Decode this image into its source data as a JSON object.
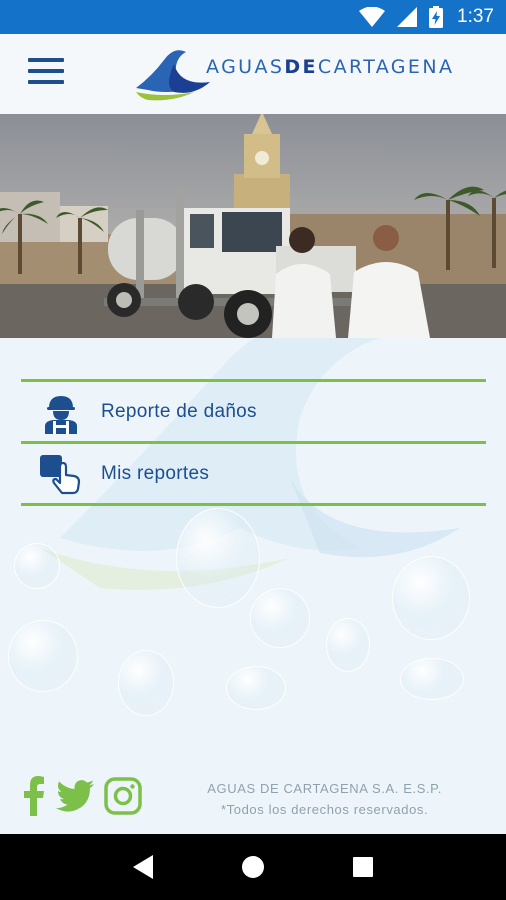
{
  "status_bar": {
    "time": "1:37",
    "icons": [
      "wifi-icon",
      "signal-icon",
      "battery-charging-icon"
    ]
  },
  "app_bar": {
    "menu_icon": "hamburger-menu-icon",
    "logo": {
      "part1": "AGUAS",
      "part2": "DE",
      "part3": "CARTAGENA"
    }
  },
  "hero": {
    "description_icon": "photo"
  },
  "menu": {
    "items": [
      {
        "label": "Reporte de daños",
        "icon": "worker-icon"
      },
      {
        "label": "Mis reportes",
        "icon": "touch-hand-icon"
      }
    ]
  },
  "footer": {
    "company": "AGUAS DE CARTAGENA S.A. E.S.P.",
    "rights": "*Todos los derechos reservados.",
    "social": [
      "facebook-icon",
      "twitter-icon",
      "instagram-icon"
    ]
  },
  "colors": {
    "primary": "#1572c9",
    "navy": "#1d4f8f",
    "green": "#7cc04a",
    "footer_text": "#8fa1ad"
  }
}
